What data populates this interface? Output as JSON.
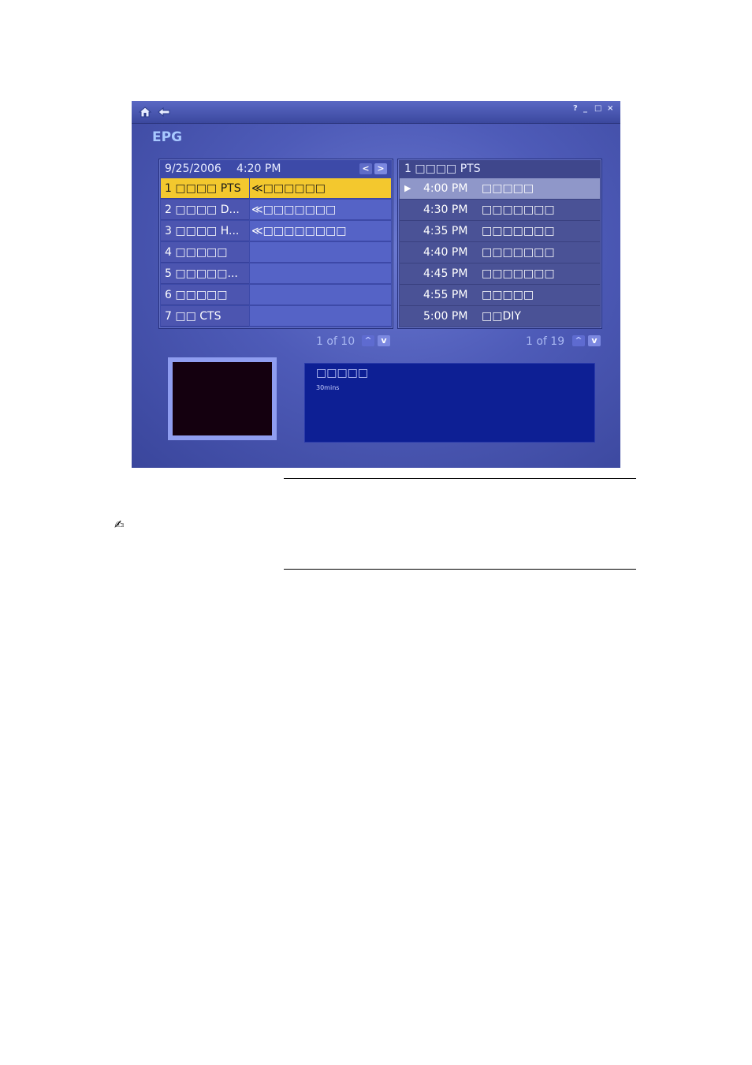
{
  "window": {
    "title": "EPG",
    "help": "?",
    "minimize": "_",
    "maximize": "□",
    "close": "×"
  },
  "channels": {
    "date": "9/25/2006",
    "time": "4:20 PM",
    "prev_icon": "<",
    "next_icon": ">",
    "rows": [
      {
        "name": "1 □□□□ PTS",
        "program": "≪□□□□□□"
      },
      {
        "name": "2 □□□□ D...",
        "program": "≪□□□□□□□"
      },
      {
        "name": "3 □□□□ H...",
        "program": "≪□□□□□□□□"
      },
      {
        "name": "4 □□□□□",
        "program": ""
      },
      {
        "name": "5 □□□□□...",
        "program": ""
      },
      {
        "name": "6 □□□□□",
        "program": ""
      },
      {
        "name": "7 □□ CTS",
        "program": ""
      }
    ],
    "pager": "1 of 10"
  },
  "programs": {
    "channel": "1 □□□□ PTS",
    "rows": [
      {
        "time": "4:00 PM",
        "name": "□□□□□"
      },
      {
        "time": "4:30 PM",
        "name": "□□□□□□□"
      },
      {
        "time": "4:35 PM",
        "name": "□□□□□□□"
      },
      {
        "time": "4:40 PM",
        "name": "□□□□□□□"
      },
      {
        "time": "4:45 PM",
        "name": "□□□□□□□"
      },
      {
        "time": "4:55 PM",
        "name": "□□□□□"
      },
      {
        "time": "5:00 PM",
        "name": "□□DIY"
      }
    ],
    "pager": "1 of 19"
  },
  "details": {
    "title": "□□□□□",
    "duration": "30mins"
  },
  "arrows": {
    "up": "^",
    "down": "v"
  },
  "note": {
    "icon": "✍"
  }
}
